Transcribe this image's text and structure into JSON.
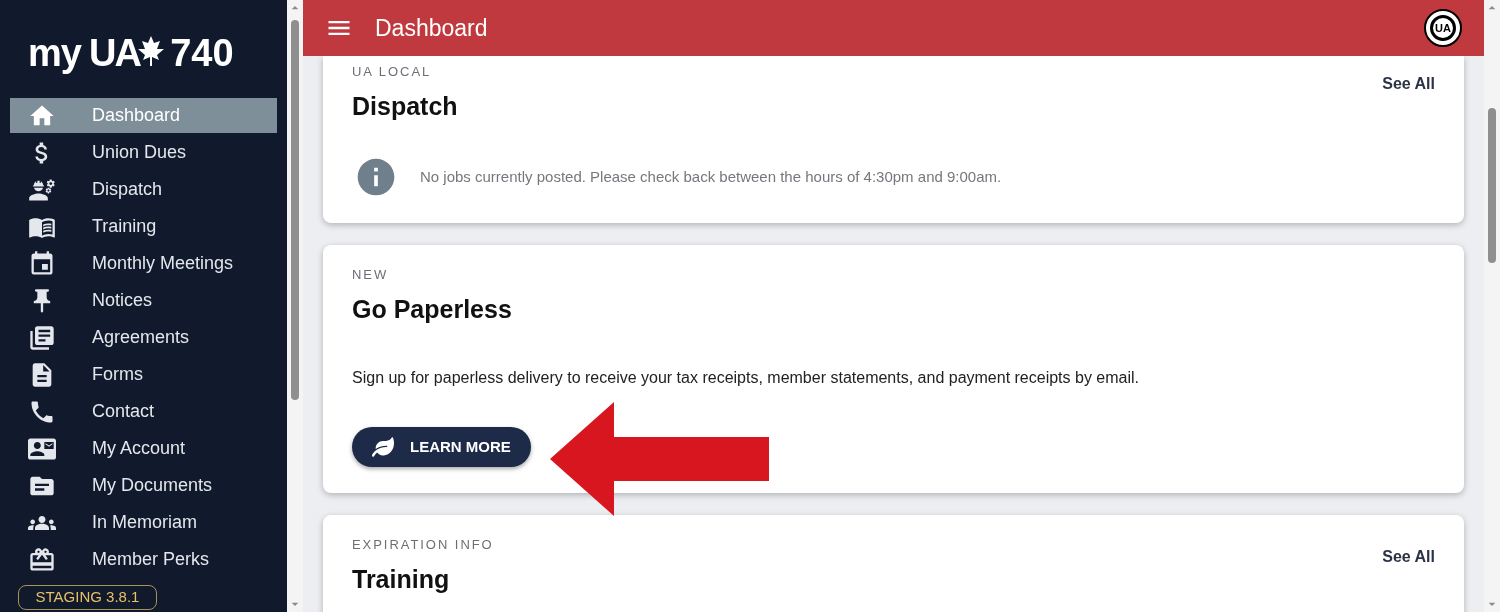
{
  "sidebar": {
    "logo": {
      "prefix": "my",
      "mark": "UA",
      "number": "740"
    },
    "items": [
      {
        "label": "Dashboard",
        "selected": true
      },
      {
        "label": "Union Dues",
        "selected": false
      },
      {
        "label": "Dispatch",
        "selected": false
      },
      {
        "label": "Training",
        "selected": false
      },
      {
        "label": "Monthly Meetings",
        "selected": false
      },
      {
        "label": "Notices",
        "selected": false
      },
      {
        "label": "Agreements",
        "selected": false
      },
      {
        "label": "Forms",
        "selected": false
      },
      {
        "label": "Contact",
        "selected": false
      },
      {
        "label": "My Account",
        "selected": false
      },
      {
        "label": "My Documents",
        "selected": false
      },
      {
        "label": "In Memoriam",
        "selected": false
      },
      {
        "label": "Member Perks",
        "selected": false
      }
    ],
    "version_badge": "STAGING 3.8.1"
  },
  "header": {
    "title": "Dashboard",
    "avatar": "UA"
  },
  "cards": [
    {
      "kind": "info",
      "overline": "UA LOCAL",
      "title": "Dispatch",
      "action": "See All",
      "message": "No jobs currently posted. Please check back between the hours of 4:30pm and 9:00am."
    },
    {
      "kind": "promo",
      "overline": "NEW",
      "title": "Go Paperless",
      "body": "Sign up for paperless delivery to receive your tax receipts, member statements, and payment receipts by email.",
      "button": "LEARN MORE"
    },
    {
      "kind": "list",
      "overline": "EXPIRATION INFO",
      "title": "Training",
      "action": "See All"
    }
  ]
}
